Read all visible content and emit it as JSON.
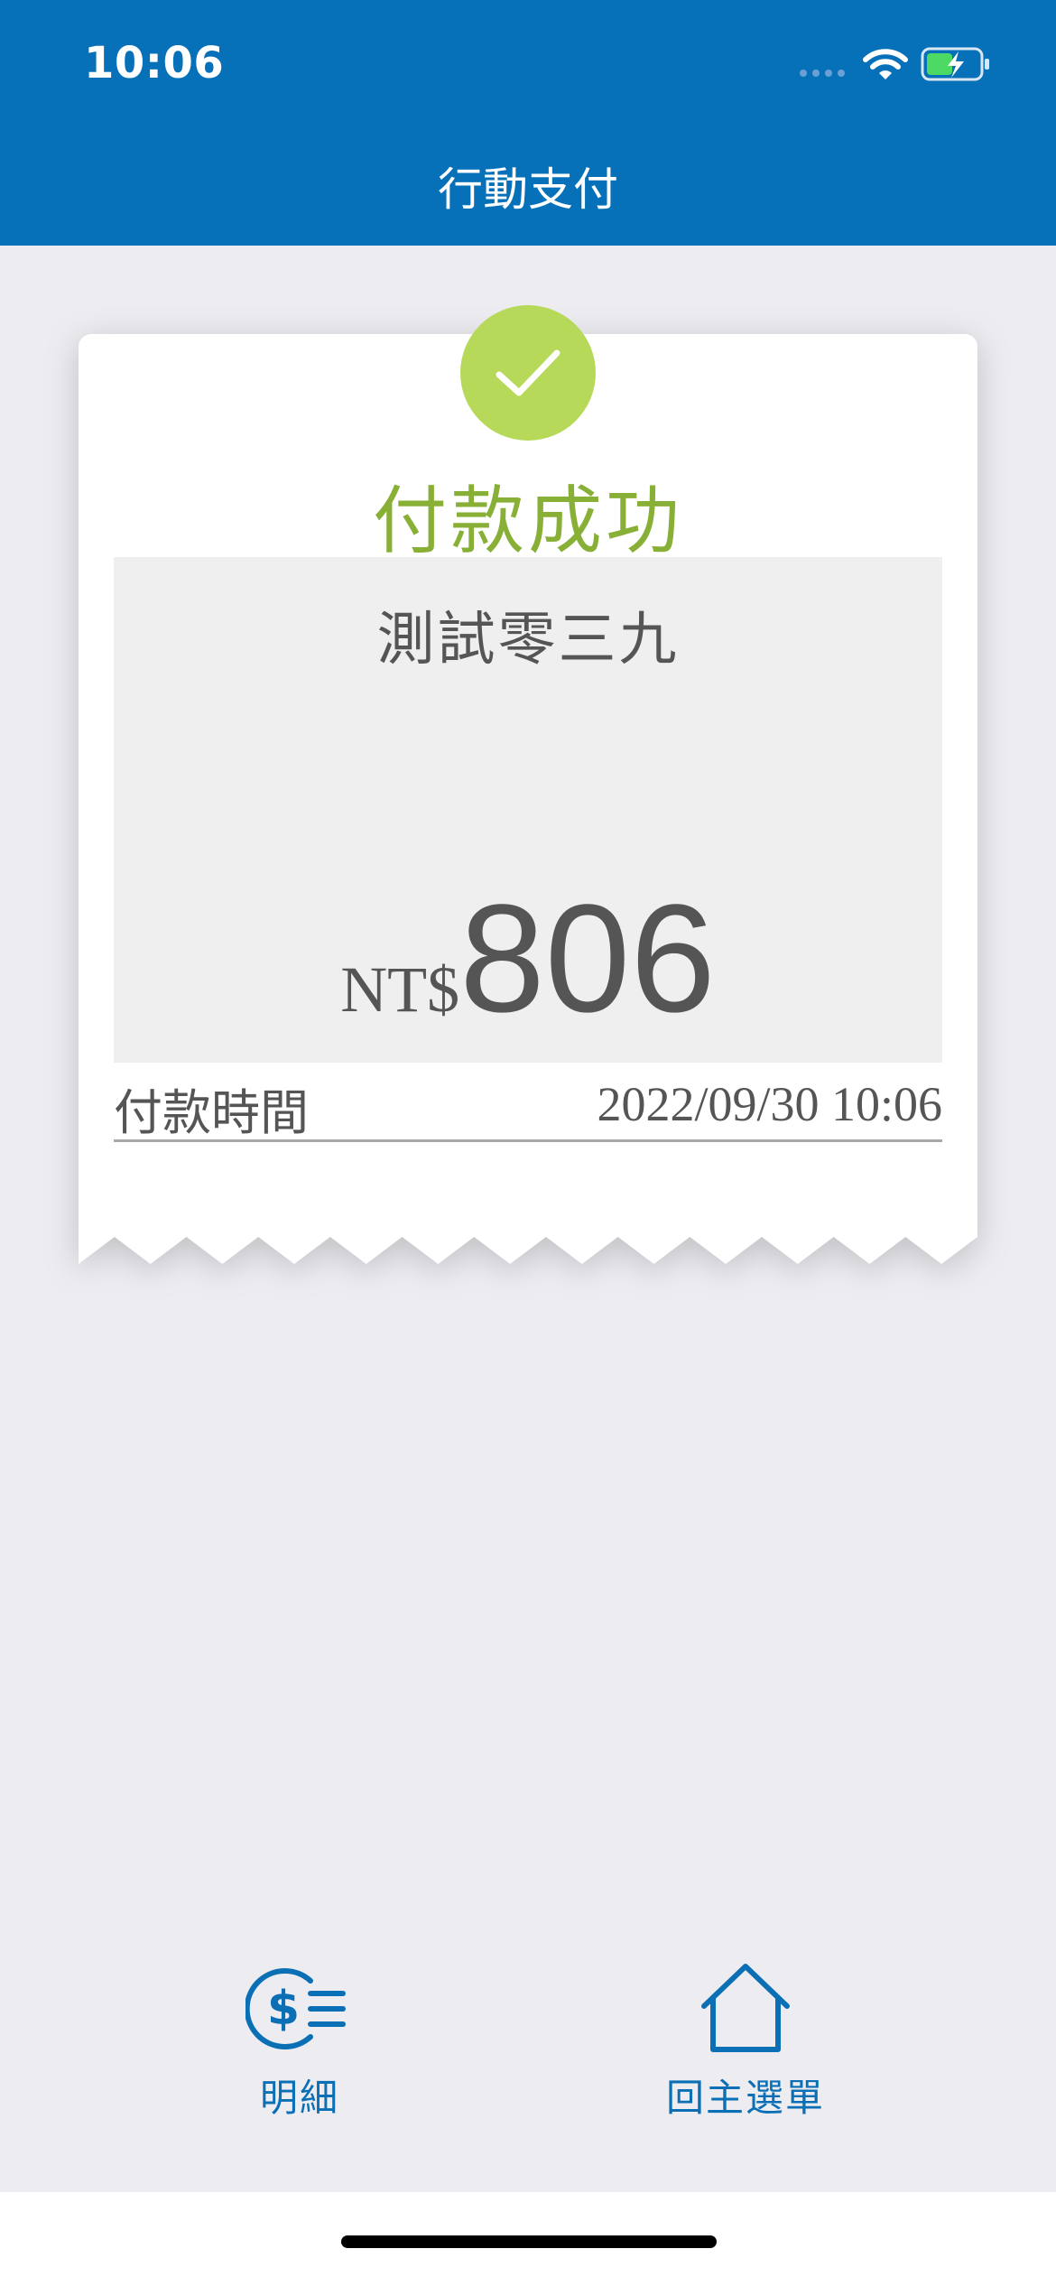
{
  "status_bar": {
    "time": "10:06"
  },
  "nav": {
    "title": "行動支付"
  },
  "receipt": {
    "status_title": "付款成功",
    "merchant": "測試零三九",
    "currency": "NT$",
    "amount": "806",
    "pay_time_label": "付款時間",
    "pay_time_value": "2022/09/30 10:06"
  },
  "bottom_nav": {
    "detail_label": "明細",
    "home_label": "回主選單"
  },
  "colors": {
    "header": "#0670b8",
    "success": "#b7d95a",
    "success_text": "#89b036",
    "nav_icon": "#0b6fb6"
  }
}
